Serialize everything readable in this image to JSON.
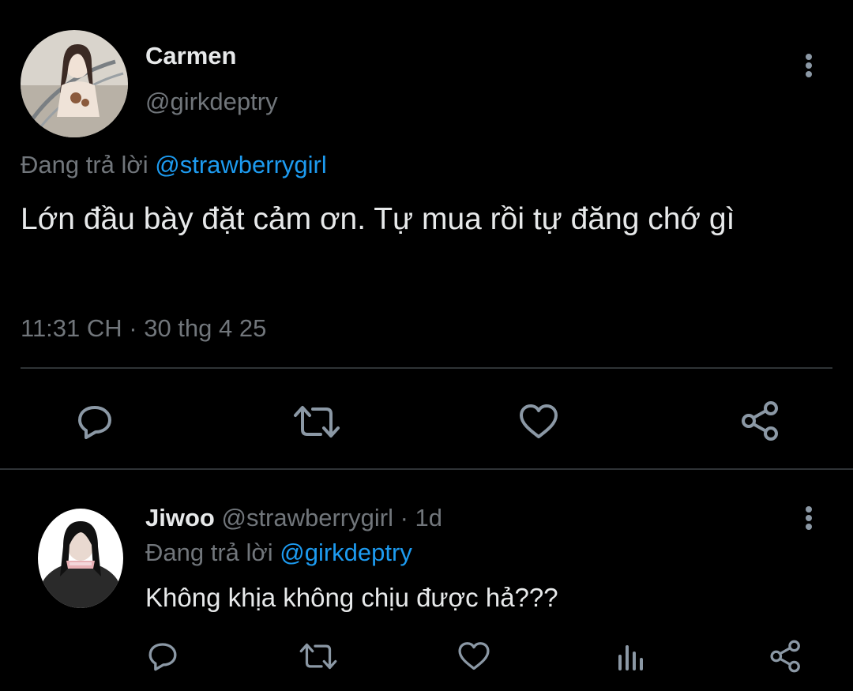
{
  "main_tweet": {
    "display_name": "Carmen",
    "handle": "@girkdeptry",
    "reply_prefix": "Đang trả lời",
    "reply_to": "@strawberrygirl",
    "text": "Lớn đầu bày đặt cảm ơn. Tự mua rồi tự đăng chớ gì",
    "timestamp": "11:31 CH · 30 thg 4 25"
  },
  "reply_tweet": {
    "display_name": "Jiwoo",
    "handle": "@strawberrygirl",
    "separator": "·",
    "age": "1d",
    "reply_prefix": "Đang trả lời",
    "reply_to": "@girkdeptry",
    "text": "Không khịa không chịu được hả???"
  },
  "icons": {
    "reply": "reply-icon",
    "retweet": "retweet-icon",
    "like": "like-icon",
    "share": "share-icon",
    "views": "views-icon",
    "more": "more-vertical-icon"
  },
  "colors": {
    "background": "#000000",
    "text": "#e7e9ea",
    "muted": "#71767b",
    "link": "#1d9bf0",
    "divider": "#2f3336",
    "icon": "#8b98a5"
  }
}
